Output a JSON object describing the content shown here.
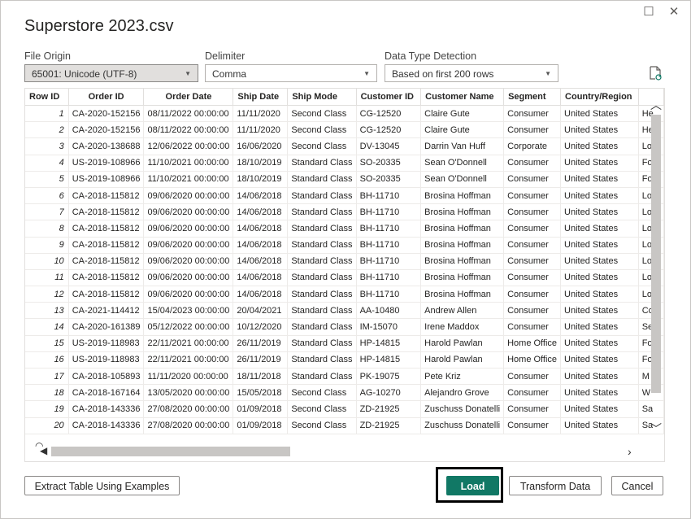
{
  "window": {
    "title": "Superstore 2023.csv",
    "maximize_glyph": "☐",
    "close_glyph": "✕"
  },
  "options": {
    "file_origin": {
      "label": "File Origin",
      "value": "65001: Unicode (UTF-8)"
    },
    "delimiter": {
      "label": "Delimiter",
      "value": "Comma"
    },
    "data_type_detection": {
      "label": "Data Type Detection",
      "value": "Based on first 200 rows"
    },
    "refresh_icon": "refresh-icon"
  },
  "table": {
    "columns": [
      "Row ID",
      "Order ID",
      "Order Date",
      "Ship Date",
      "Ship Mode",
      "Customer ID",
      "Customer Name",
      "Segment",
      "Country/Region",
      ""
    ],
    "rows": [
      [
        "1",
        "CA-2020-152156",
        "08/11/2022 00:00:00",
        "11/11/2020",
        "Second Class",
        "CG-12520",
        "Claire Gute",
        "Consumer",
        "United States",
        "He"
      ],
      [
        "2",
        "CA-2020-152156",
        "08/11/2022 00:00:00",
        "11/11/2020",
        "Second Class",
        "CG-12520",
        "Claire Gute",
        "Consumer",
        "United States",
        "He"
      ],
      [
        "3",
        "CA-2020-138688",
        "12/06/2022 00:00:00",
        "16/06/2020",
        "Second Class",
        "DV-13045",
        "Darrin Van Huff",
        "Corporate",
        "United States",
        "Lo"
      ],
      [
        "4",
        "US-2019-108966",
        "11/10/2021 00:00:00",
        "18/10/2019",
        "Standard Class",
        "SO-20335",
        "Sean O'Donnell",
        "Consumer",
        "United States",
        "Fo"
      ],
      [
        "5",
        "US-2019-108966",
        "11/10/2021 00:00:00",
        "18/10/2019",
        "Standard Class",
        "SO-20335",
        "Sean O'Donnell",
        "Consumer",
        "United States",
        "Fo"
      ],
      [
        "6",
        "CA-2018-115812",
        "09/06/2020 00:00:00",
        "14/06/2018",
        "Standard Class",
        "BH-11710",
        "Brosina Hoffman",
        "Consumer",
        "United States",
        "Lo"
      ],
      [
        "7",
        "CA-2018-115812",
        "09/06/2020 00:00:00",
        "14/06/2018",
        "Standard Class",
        "BH-11710",
        "Brosina Hoffman",
        "Consumer",
        "United States",
        "Lo"
      ],
      [
        "8",
        "CA-2018-115812",
        "09/06/2020 00:00:00",
        "14/06/2018",
        "Standard Class",
        "BH-11710",
        "Brosina Hoffman",
        "Consumer",
        "United States",
        "Lo"
      ],
      [
        "9",
        "CA-2018-115812",
        "09/06/2020 00:00:00",
        "14/06/2018",
        "Standard Class",
        "BH-11710",
        "Brosina Hoffman",
        "Consumer",
        "United States",
        "Lo"
      ],
      [
        "10",
        "CA-2018-115812",
        "09/06/2020 00:00:00",
        "14/06/2018",
        "Standard Class",
        "BH-11710",
        "Brosina Hoffman",
        "Consumer",
        "United States",
        "Lo"
      ],
      [
        "11",
        "CA-2018-115812",
        "09/06/2020 00:00:00",
        "14/06/2018",
        "Standard Class",
        "BH-11710",
        "Brosina Hoffman",
        "Consumer",
        "United States",
        "Lo"
      ],
      [
        "12",
        "CA-2018-115812",
        "09/06/2020 00:00:00",
        "14/06/2018",
        "Standard Class",
        "BH-11710",
        "Brosina Hoffman",
        "Consumer",
        "United States",
        "Lo"
      ],
      [
        "13",
        "CA-2021-114412",
        "15/04/2023 00:00:00",
        "20/04/2021",
        "Standard Class",
        "AA-10480",
        "Andrew Allen",
        "Consumer",
        "United States",
        "Co"
      ],
      [
        "14",
        "CA-2020-161389",
        "05/12/2022 00:00:00",
        "10/12/2020",
        "Standard Class",
        "IM-15070",
        "Irene Maddox",
        "Consumer",
        "United States",
        "Se"
      ],
      [
        "15",
        "US-2019-118983",
        "22/11/2021 00:00:00",
        "26/11/2019",
        "Standard Class",
        "HP-14815",
        "Harold Pawlan",
        "Home Office",
        "United States",
        "Fo"
      ],
      [
        "16",
        "US-2019-118983",
        "22/11/2021 00:00:00",
        "26/11/2019",
        "Standard Class",
        "HP-14815",
        "Harold Pawlan",
        "Home Office",
        "United States",
        "Fo"
      ],
      [
        "17",
        "CA-2018-105893",
        "11/11/2020 00:00:00",
        "18/11/2018",
        "Standard Class",
        "PK-19075",
        "Pete Kriz",
        "Consumer",
        "United States",
        "M"
      ],
      [
        "18",
        "CA-2018-167164",
        "13/05/2020 00:00:00",
        "15/05/2018",
        "Second Class",
        "AG-10270",
        "Alejandro Grove",
        "Consumer",
        "United States",
        "W"
      ],
      [
        "19",
        "CA-2018-143336",
        "27/08/2020 00:00:00",
        "01/09/2018",
        "Second Class",
        "ZD-21925",
        "Zuschuss Donatelli",
        "Consumer",
        "United States",
        "Sa"
      ],
      [
        "20",
        "CA-2018-143336",
        "27/08/2020 00:00:00",
        "01/09/2018",
        "Second Class",
        "ZD-21925",
        "Zuschuss Donatelli",
        "Consumer",
        "United States",
        "Sa"
      ]
    ]
  },
  "buttons": {
    "extract": "Extract Table Using Examples",
    "load": "Load",
    "transform": "Transform Data",
    "cancel": "Cancel"
  }
}
